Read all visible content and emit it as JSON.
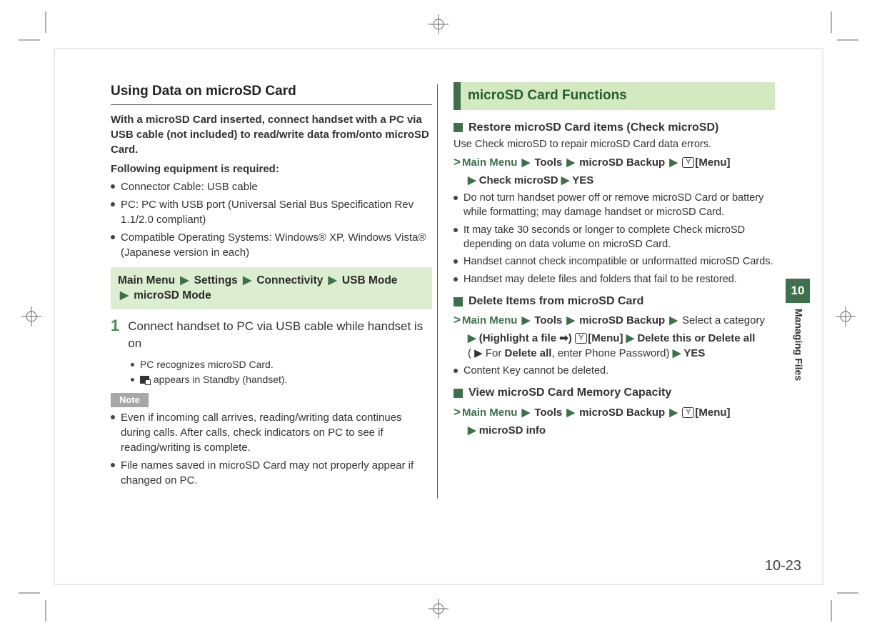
{
  "left": {
    "title": "Using Data on microSD Card",
    "intro1": "With a microSD Card inserted, connect handset with a PC via USB cable (not included) to read/write data from/onto microSD Card.",
    "intro2": "Following equipment is required:",
    "equip": [
      "Connector Cable: USB cable",
      "PC: PC with USB port (Universal Serial Bus Specification Rev 1.1/2.0 compliant)",
      "Compatible Operating Systems: Windows® XP, Windows Vista® (Japanese version in each)"
    ],
    "nav": {
      "items": [
        "Main Menu",
        "Settings",
        "Connectivity",
        "USB Mode",
        "microSD Mode"
      ]
    },
    "step1_num": "1",
    "step1_text": "Connect handset to PC via USB cable while handset is on",
    "step1_subs": [
      "PC recognizes microSD Card.",
      " appears in Standby (handset)."
    ],
    "note_label": "Note",
    "notes": [
      "Even if incoming call arrives, reading/writing data continues during calls. After calls, check indicators on PC to see if reading/writing is complete.",
      "File names saved in microSD Card may not properly appear if changed on PC."
    ]
  },
  "right": {
    "banner": "microSD Card Functions",
    "sec1": {
      "head": "Restore microSD Card items (Check microSD)",
      "desc": "Use Check microSD to repair microSD Card data errors.",
      "crumb_line1": {
        "mm": "Main Menu",
        "a": "Tools",
        "b": "microSD Backup",
        "btn": "[Menu]"
      },
      "crumb_line2": {
        "a": "Check microSD",
        "b": "YES"
      },
      "bullets": [
        "Do not turn handset power off or remove microSD Card or battery while formatting; may damage handset or microSD Card.",
        "It may take 30 seconds or longer to complete Check microSD depending on data volume on microSD Card.",
        "Handset cannot check incompatible or unformatted microSD Cards.",
        "Handset may delete files and folders that fail to be restored."
      ]
    },
    "sec2": {
      "head": "Delete Items from microSD Card",
      "crumb_l1": {
        "mm": "Main Menu",
        "a": "Tools",
        "b": "microSD Backup",
        "tail": "Select a category"
      },
      "crumb_l2_pre": "(Highlight a file ➡)",
      "crumb_l2_btn": "[Menu]",
      "crumb_l2_a": "Delete this",
      "crumb_l2_or": "or",
      "crumb_l2_b": "Delete all",
      "crumb_l3_pre": "( ▶ For",
      "crumb_l3_b": "Delete all",
      "crumb_l3_mid": ", enter Phone Password)",
      "crumb_l3_yes": "YES",
      "bullets": [
        "Content Key cannot be deleted."
      ]
    },
    "sec3": {
      "head": "View microSD Card Memory Capacity",
      "crumb_l1": {
        "mm": "Main Menu",
        "a": "Tools",
        "b": "microSD Backup",
        "btn": "[Menu]"
      },
      "crumb_l2": "microSD info"
    }
  },
  "side": {
    "chapter": "10",
    "label": "Managing Files"
  },
  "pagenum": "10-23",
  "glyphs": {
    "arrow": "▶",
    "gt": ">",
    "key": "Y̲"
  }
}
